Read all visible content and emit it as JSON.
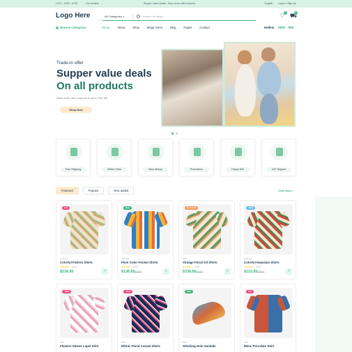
{
  "topbar": {
    "phone": "(+01) - 2345 - 6789",
    "location": "Our location",
    "promo": "Supper Value Deals - Save more with coupons",
    "language": "English",
    "account": "Log in / Sign Up"
  },
  "header": {
    "logo": "Logo Here",
    "category_select": "All Categories",
    "search_placeholder": "Search for items...",
    "wishlist_count": "0",
    "cart_count": "0"
  },
  "nav": {
    "browse": "Browse Categories",
    "menu": [
      "Home",
      "About",
      "Shop",
      "Mega menu",
      "Blog",
      "Pages",
      "Contact"
    ],
    "hotline_label": "Hotline",
    "hotline_price": "$900 - 888"
  },
  "hero": {
    "pretitle": "Trade-in offer",
    "title1": "Supper value deals",
    "title2": "On all products",
    "subtitle": "Save more with coupons & up to 70% off!",
    "button": "Shop Now"
  },
  "features": [
    "Free Shipping",
    "Online Order",
    "Save Money",
    "Promotions",
    "Happy Sell",
    "24/7 Support"
  ],
  "tabs": [
    "Featured",
    "Popular",
    "New added"
  ],
  "view_more": "View More",
  "products": [
    {
      "badge": "Hot",
      "category": "Clothing",
      "name": "Colorful Pattern Shirts",
      "rating": "(4.0)",
      "price": "$238.85",
      "old": "",
      "badge_color": "#f74b81"
    },
    {
      "badge": "New",
      "category": "Clothing",
      "name": "Plain Color Pocket Shirts",
      "rating": "(4.0)",
      "price": "$138.85",
      "old": "$255.8",
      "badge_color": "#3BB77E"
    },
    {
      "badge": "Best Sell",
      "category": "Shirt",
      "name": "Vintage Floral Oil Shirts",
      "rating": "(3.5)",
      "price": "$338.85",
      "old": "$445.8",
      "badge_color": "#f59758"
    },
    {
      "badge": "-30%",
      "category": "Clothing",
      "name": "Colorful Hawaiian Shirts",
      "rating": "(4.5)",
      "price": "$123.85",
      "old": "$235.8",
      "badge_color": "#67bcee"
    },
    {
      "badge": "-22%",
      "category": "Shirt",
      "name": "Flowers Sleeve Lapel Shirt",
      "rating": "",
      "price": "",
      "old": "",
      "badge_color": "#f74b81"
    },
    {
      "badge": "-22%",
      "category": "Shirt",
      "name": "Ethnic Floral Casual Shirts",
      "rating": "",
      "price": "",
      "old": "",
      "badge_color": "#f74b81"
    },
    {
      "badge": "New",
      "category": "Shoe",
      "name": "Stitching Hole Sandals",
      "rating": "",
      "price": "",
      "old": "",
      "badge_color": "#3BB77E"
    },
    {
      "badge": "Hot",
      "category": "Shirt",
      "name": "Mens Porcelain Shirt",
      "rating": "",
      "price": "",
      "old": "",
      "badge_color": "#f74b81"
    }
  ],
  "colors": {
    "brand": "#3BB77E",
    "dark": "#253D4E",
    "accent": "#fde9cb"
  }
}
